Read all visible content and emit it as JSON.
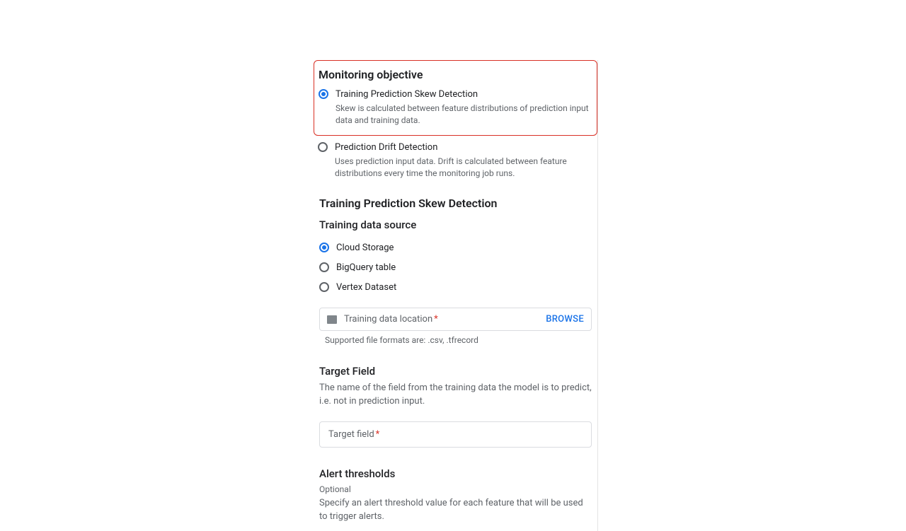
{
  "monitoringObjective": {
    "title": "Monitoring objective",
    "options": [
      {
        "label": "Training Prediction Skew Detection",
        "desc": "Skew is calculated between feature distributions of prediction input data and training data."
      },
      {
        "label": "Prediction Drift Detection",
        "desc": "Uses prediction input data. Drift is calculated between feature distributions every time the monitoring job runs."
      }
    ]
  },
  "skewSection": {
    "title": "Training Prediction Skew Detection",
    "dataSource": {
      "title": "Training data source",
      "options": [
        "Cloud Storage",
        "BigQuery table",
        "Vertex Dataset"
      ]
    },
    "locationField": {
      "placeholder": "Training data location",
      "browse": "BROWSE",
      "helper": "Supported file formats are: .csv, .tfrecord"
    }
  },
  "targetField": {
    "title": "Target Field",
    "desc": "The name of the field from the training data the model is to predict, i.e. not in prediction input.",
    "placeholder": "Target field"
  },
  "alertThresholds": {
    "title": "Alert thresholds",
    "optional": "Optional",
    "desc": "Specify an alert threshold value for each feature that will be used to trigger alerts."
  }
}
